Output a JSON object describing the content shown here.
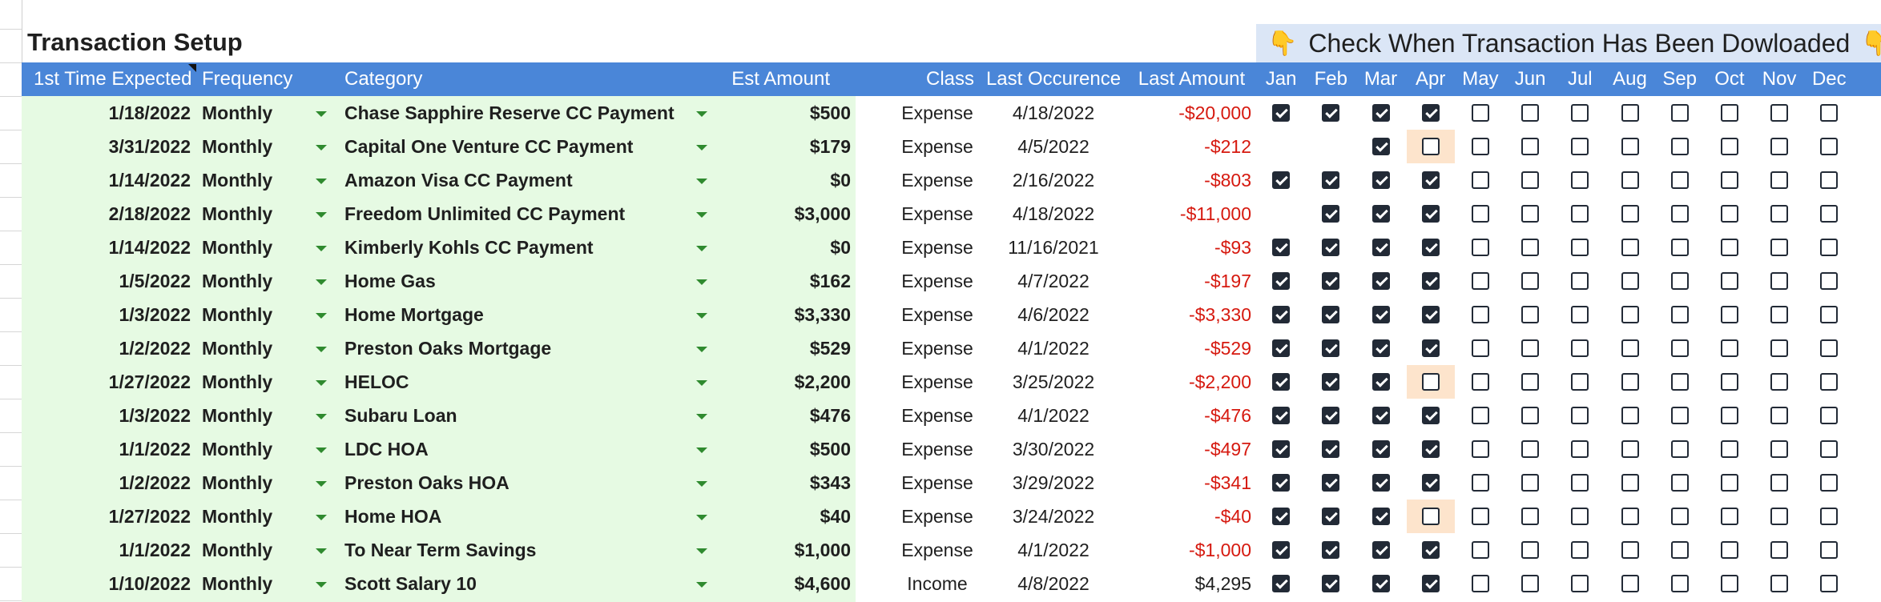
{
  "title": "Transaction Setup",
  "banner": {
    "icon_left": "👇",
    "text": "Check When Transaction Has Been Dowloaded",
    "icon_right": "👇"
  },
  "headers": {
    "first_time": "1st Time Expected",
    "frequency": "Frequency",
    "category": "Category",
    "est_amount": "Est Amount",
    "class": "Class",
    "last_occurence": "Last Occurence",
    "last_amount": "Last Amount",
    "months": [
      "Jan",
      "Feb",
      "Mar",
      "Apr",
      "May",
      "Jun",
      "Jul",
      "Aug",
      "Sep",
      "Oct",
      "Nov",
      "Dec"
    ]
  },
  "colors": {
    "header_blue": "#4a86d8",
    "input_green": "#e6fae3",
    "negative_red": "#d6190f",
    "dropdown_green": "#2f8a2f",
    "highlight_peach": "#fde4cc"
  },
  "rows": [
    {
      "first": "1/18/2022",
      "freq": "Monthly",
      "category": "Chase Sapphire Reserve CC Payment",
      "est": "$500",
      "class": "Expense",
      "last_date": "4/18/2022",
      "last_amount": "-$20,000",
      "neg": true,
      "checks": [
        "on",
        "on",
        "on",
        "on",
        "off",
        "off",
        "off",
        "off",
        "off",
        "off",
        "off",
        "off"
      ],
      "highlight_apr": false
    },
    {
      "first": "3/31/2022",
      "freq": "Monthly",
      "category": "Capital One Venture CC Payment",
      "est": "$179",
      "class": "Expense",
      "last_date": "4/5/2022",
      "last_amount": "-$212",
      "neg": true,
      "checks": [
        "none",
        "none",
        "on",
        "off",
        "off",
        "off",
        "off",
        "off",
        "off",
        "off",
        "off",
        "off"
      ],
      "highlight_apr": true
    },
    {
      "first": "1/14/2022",
      "freq": "Monthly",
      "category": "Amazon Visa CC Payment",
      "est": "$0",
      "class": "Expense",
      "last_date": "2/16/2022",
      "last_amount": "-$803",
      "neg": true,
      "checks": [
        "on",
        "on",
        "on",
        "on",
        "off",
        "off",
        "off",
        "off",
        "off",
        "off",
        "off",
        "off"
      ],
      "highlight_apr": false
    },
    {
      "first": "2/18/2022",
      "freq": "Monthly",
      "category": "Freedom Unlimited CC Payment",
      "est": "$3,000",
      "class": "Expense",
      "last_date": "4/18/2022",
      "last_amount": "-$11,000",
      "neg": true,
      "checks": [
        "none",
        "on",
        "on",
        "on",
        "off",
        "off",
        "off",
        "off",
        "off",
        "off",
        "off",
        "off"
      ],
      "highlight_apr": false
    },
    {
      "first": "1/14/2022",
      "freq": "Monthly",
      "category": "Kimberly Kohls CC Payment",
      "est": "$0",
      "class": "Expense",
      "last_date": "11/16/2021",
      "last_amount": "-$93",
      "neg": true,
      "checks": [
        "on",
        "on",
        "on",
        "on",
        "off",
        "off",
        "off",
        "off",
        "off",
        "off",
        "off",
        "off"
      ],
      "highlight_apr": false
    },
    {
      "first": "1/5/2022",
      "freq": "Monthly",
      "category": "Home Gas",
      "est": "$162",
      "class": "Expense",
      "last_date": "4/7/2022",
      "last_amount": "-$197",
      "neg": true,
      "checks": [
        "on",
        "on",
        "on",
        "on",
        "off",
        "off",
        "off",
        "off",
        "off",
        "off",
        "off",
        "off"
      ],
      "highlight_apr": false
    },
    {
      "first": "1/3/2022",
      "freq": "Monthly",
      "category": "Home Mortgage",
      "est": "$3,330",
      "class": "Expense",
      "last_date": "4/6/2022",
      "last_amount": "-$3,330",
      "neg": true,
      "checks": [
        "on",
        "on",
        "on",
        "on",
        "off",
        "off",
        "off",
        "off",
        "off",
        "off",
        "off",
        "off"
      ],
      "highlight_apr": false
    },
    {
      "first": "1/2/2022",
      "freq": "Monthly",
      "category": "Preston Oaks Mortgage",
      "est": "$529",
      "class": "Expense",
      "last_date": "4/1/2022",
      "last_amount": "-$529",
      "neg": true,
      "checks": [
        "on",
        "on",
        "on",
        "on",
        "off",
        "off",
        "off",
        "off",
        "off",
        "off",
        "off",
        "off"
      ],
      "highlight_apr": false
    },
    {
      "first": "1/27/2022",
      "freq": "Monthly",
      "category": "HELOC",
      "est": "$2,200",
      "class": "Expense",
      "last_date": "3/25/2022",
      "last_amount": "-$2,200",
      "neg": true,
      "checks": [
        "on",
        "on",
        "on",
        "off",
        "off",
        "off",
        "off",
        "off",
        "off",
        "off",
        "off",
        "off"
      ],
      "highlight_apr": true
    },
    {
      "first": "1/3/2022",
      "freq": "Monthly",
      "category": "Subaru Loan",
      "est": "$476",
      "class": "Expense",
      "last_date": "4/1/2022",
      "last_amount": "-$476",
      "neg": true,
      "checks": [
        "on",
        "on",
        "on",
        "on",
        "off",
        "off",
        "off",
        "off",
        "off",
        "off",
        "off",
        "off"
      ],
      "highlight_apr": false
    },
    {
      "first": "1/1/2022",
      "freq": "Monthly",
      "category": "LDC HOA",
      "est": "$500",
      "class": "Expense",
      "last_date": "3/30/2022",
      "last_amount": "-$497",
      "neg": true,
      "checks": [
        "on",
        "on",
        "on",
        "on",
        "off",
        "off",
        "off",
        "off",
        "off",
        "off",
        "off",
        "off"
      ],
      "highlight_apr": false
    },
    {
      "first": "1/2/2022",
      "freq": "Monthly",
      "category": "Preston Oaks HOA",
      "est": "$343",
      "class": "Expense",
      "last_date": "3/29/2022",
      "last_amount": "-$341",
      "neg": true,
      "checks": [
        "on",
        "on",
        "on",
        "on",
        "off",
        "off",
        "off",
        "off",
        "off",
        "off",
        "off",
        "off"
      ],
      "highlight_apr": false
    },
    {
      "first": "1/27/2022",
      "freq": "Monthly",
      "category": "Home HOA",
      "est": "$40",
      "class": "Expense",
      "last_date": "3/24/2022",
      "last_amount": "-$40",
      "neg": true,
      "checks": [
        "on",
        "on",
        "on",
        "off",
        "off",
        "off",
        "off",
        "off",
        "off",
        "off",
        "off",
        "off"
      ],
      "highlight_apr": true
    },
    {
      "first": "1/1/2022",
      "freq": "Monthly",
      "category": "To Near Term Savings",
      "est": "$1,000",
      "class": "Expense",
      "last_date": "4/1/2022",
      "last_amount": "-$1,000",
      "neg": true,
      "checks": [
        "on",
        "on",
        "on",
        "on",
        "off",
        "off",
        "off",
        "off",
        "off",
        "off",
        "off",
        "off"
      ],
      "highlight_apr": false
    },
    {
      "first": "1/10/2022",
      "freq": "Monthly",
      "category": "Scott Salary 10",
      "est": "$4,600",
      "class": "Income",
      "last_date": "4/8/2022",
      "last_amount": "$4,295",
      "neg": false,
      "checks": [
        "on",
        "on",
        "on",
        "on",
        "off",
        "off",
        "off",
        "off",
        "off",
        "off",
        "off",
        "off"
      ],
      "highlight_apr": false
    }
  ]
}
